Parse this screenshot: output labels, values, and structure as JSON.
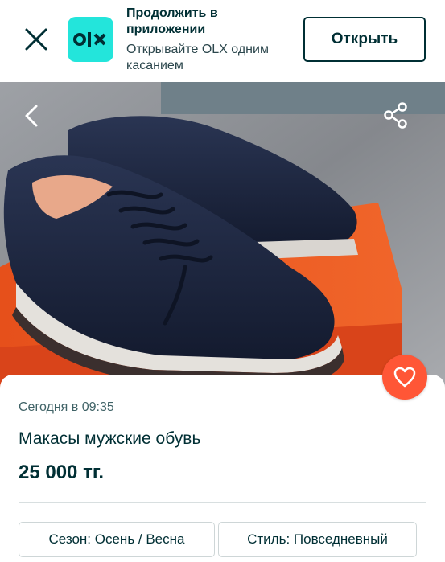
{
  "banner": {
    "title": "Продолжить в приложении",
    "subtitle": "Открывайте OLX одним касанием",
    "open_label": "Открыть",
    "logo_text": "OLX",
    "logo_color": "#23e5db"
  },
  "photo": {
    "back_icon": "chevron-left-icon",
    "share_icon": "share-icon"
  },
  "favorite": {
    "icon": "heart-icon",
    "color": "#ff5636"
  },
  "listing": {
    "date": "Сегодня в 09:35",
    "title": "Макасы мужские обувь",
    "price": "25 000 тг."
  },
  "tags": [
    {
      "text": "Сезон: Осень / Весна"
    },
    {
      "text": "Стиль: Повседневный"
    }
  ]
}
